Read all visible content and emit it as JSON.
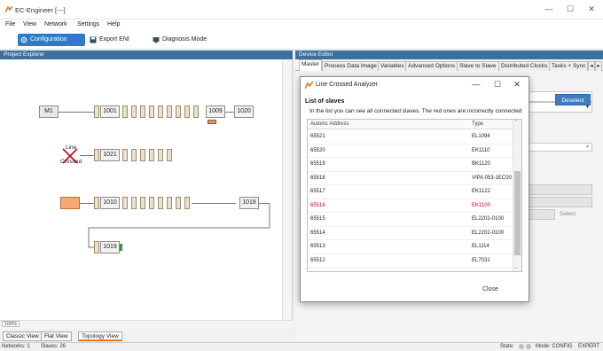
{
  "app": {
    "title": "EC-Engineer [---]",
    "brand_color": "#e87722",
    "accent": "#2c7ac9",
    "error_color": "#d0021b"
  },
  "window_controls": {
    "minimize": "—",
    "maximize": "☐",
    "close": "✕"
  },
  "menu": {
    "items": [
      "File",
      "View",
      "Network",
      "Settings",
      "Help"
    ]
  },
  "toolbar": {
    "config_mode": "Configuration Mode",
    "export_eni": "Export ENI",
    "diagnosis_mode": "Diagnosis Mode"
  },
  "project_explorer": {
    "header": "Project Explorer",
    "zoom": "100%",
    "view_tabs": [
      "Classic View",
      "Flat View",
      "Topology View"
    ],
    "nodes": {
      "m1": "M1",
      "n1001": "1001",
      "n1009": "1009",
      "n1020": "1020",
      "line_crossed_top": "Line",
      "line_crossed_bottom": "Crossed",
      "n1021": "1021",
      "n1010": "1010",
      "n1018": "1018",
      "n1019": "1019"
    }
  },
  "device_editor": {
    "header": "Device Editor",
    "tabs": [
      "Master",
      "Process Data Image",
      "Variables",
      "Advanced Options",
      "Slave to Slave",
      "Distributed Clocks",
      "Tasks + Sync"
    ],
    "deselect": "Deselect",
    "select": "Select"
  },
  "dialog": {
    "title": "Line Crossed Analyzer",
    "heading": "List of slaves",
    "description": "In the list you can see all connected slaves. The red ones are incorrectly connected",
    "columns": [
      "Autoinc Address",
      "Type"
    ],
    "rows": [
      {
        "address": "65521",
        "type": "EL1094",
        "error": false
      },
      {
        "address": "65520",
        "type": "EK1110",
        "error": false
      },
      {
        "address": "65519",
        "type": "BK1120",
        "error": false
      },
      {
        "address": "65518",
        "type": "VIPA 053-1EC00",
        "error": false
      },
      {
        "address": "65517",
        "type": "EK1122",
        "error": false
      },
      {
        "address": "65516",
        "type": "EK1100",
        "error": true
      },
      {
        "address": "65515",
        "type": "EL2202-0100",
        "error": false
      },
      {
        "address": "65514",
        "type": "EL2202-0100",
        "error": false
      },
      {
        "address": "65513",
        "type": "EL1114",
        "error": false
      },
      {
        "address": "65512",
        "type": "EL7031",
        "error": false
      },
      {
        "address": "65511",
        "type": "EL7201",
        "error": false
      }
    ],
    "close": "Close"
  },
  "status": {
    "networks": "Networks: 1",
    "slaves": "Slaves: 26",
    "state": "State:",
    "mode": "Mode: CONFIG",
    "expert": "EXPERT"
  }
}
